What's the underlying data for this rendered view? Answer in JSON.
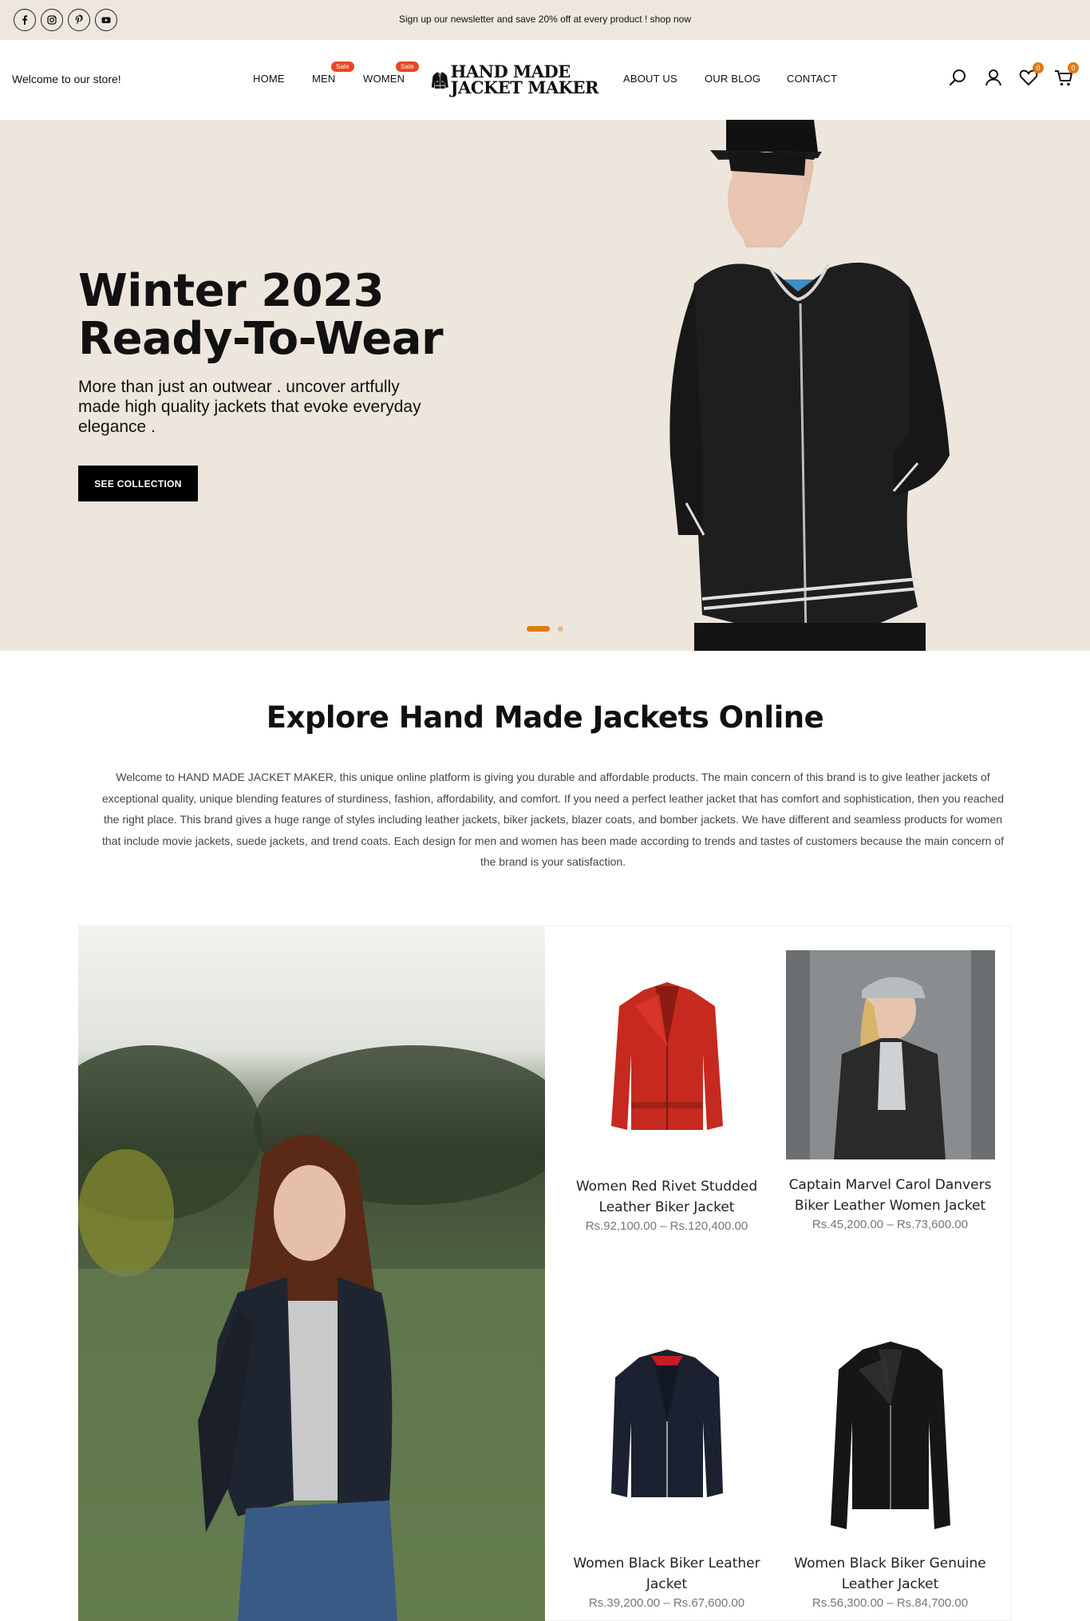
{
  "topbar": {
    "announcement": "Sign up our newsletter and save 20% off at every product ! shop now",
    "social": [
      {
        "name": "facebook-icon"
      },
      {
        "name": "instagram-icon"
      },
      {
        "name": "pinterest-icon"
      },
      {
        "name": "youtube-icon"
      }
    ]
  },
  "header": {
    "welcome": "Welcome to our store!",
    "nav": {
      "home": "HOME",
      "men": "MEN",
      "women": "WOMEN",
      "about": "ABOUT US",
      "blog": "OUR BLOG",
      "contact": "CONTACT"
    },
    "sale_badge": "Sale",
    "logo_line1": "HAND MADE",
    "logo_line2": "JACKET MAKER",
    "wishlist_count": "0",
    "cart_count": "0"
  },
  "hero": {
    "title_line1": "Winter 2023",
    "title_line2": "Ready-To-Wear",
    "subtitle": "More than just an outwear . uncover artfully made high quality jackets that evoke everyday elegance .",
    "button": "SEE COLLECTION",
    "slides": 2,
    "active_slide": 1
  },
  "explore": {
    "title": "Explore Hand Made Jackets Online",
    "text": "Welcome to HAND MADE JACKET MAKER, this unique online platform is giving you durable and affordable products. The main concern of this brand is to give leather jackets of exceptional quality, unique blending features of sturdiness, fashion, affordability, and comfort. If you need a perfect leather jacket that has comfort and sophistication, then you reached the right place. This brand gives a huge range of styles including leather jackets, biker jackets, blazer coats, and bomber jackets. We have different and seamless products for women that include movie jackets, suede jackets, and trend coats. Each design for men and women has been made according to trends and tastes of customers because the main concern of the brand is your satisfaction."
  },
  "products": [
    {
      "name": "Women Red Rivet Studded Leather Biker Jacket",
      "price": "Rs.92,100.00 – Rs.120,400.00"
    },
    {
      "name": "Captain Marvel Carol Danvers Biker Leather Women Jacket",
      "price": "Rs.45,200.00 – Rs.73,600.00"
    },
    {
      "name": "Women Black Biker Leather Jacket",
      "price": "Rs.39,200.00 – Rs.67,600.00"
    },
    {
      "name": "Women Black Biker Genuine Leather Jacket",
      "price": "Rs.56,300.00 – Rs.84,700.00"
    }
  ],
  "colors": {
    "topbar_bg": "#eee7df",
    "hero_bg": "#ede6dd",
    "accent": "#e07a16",
    "sale_badge": "#e8471f"
  }
}
